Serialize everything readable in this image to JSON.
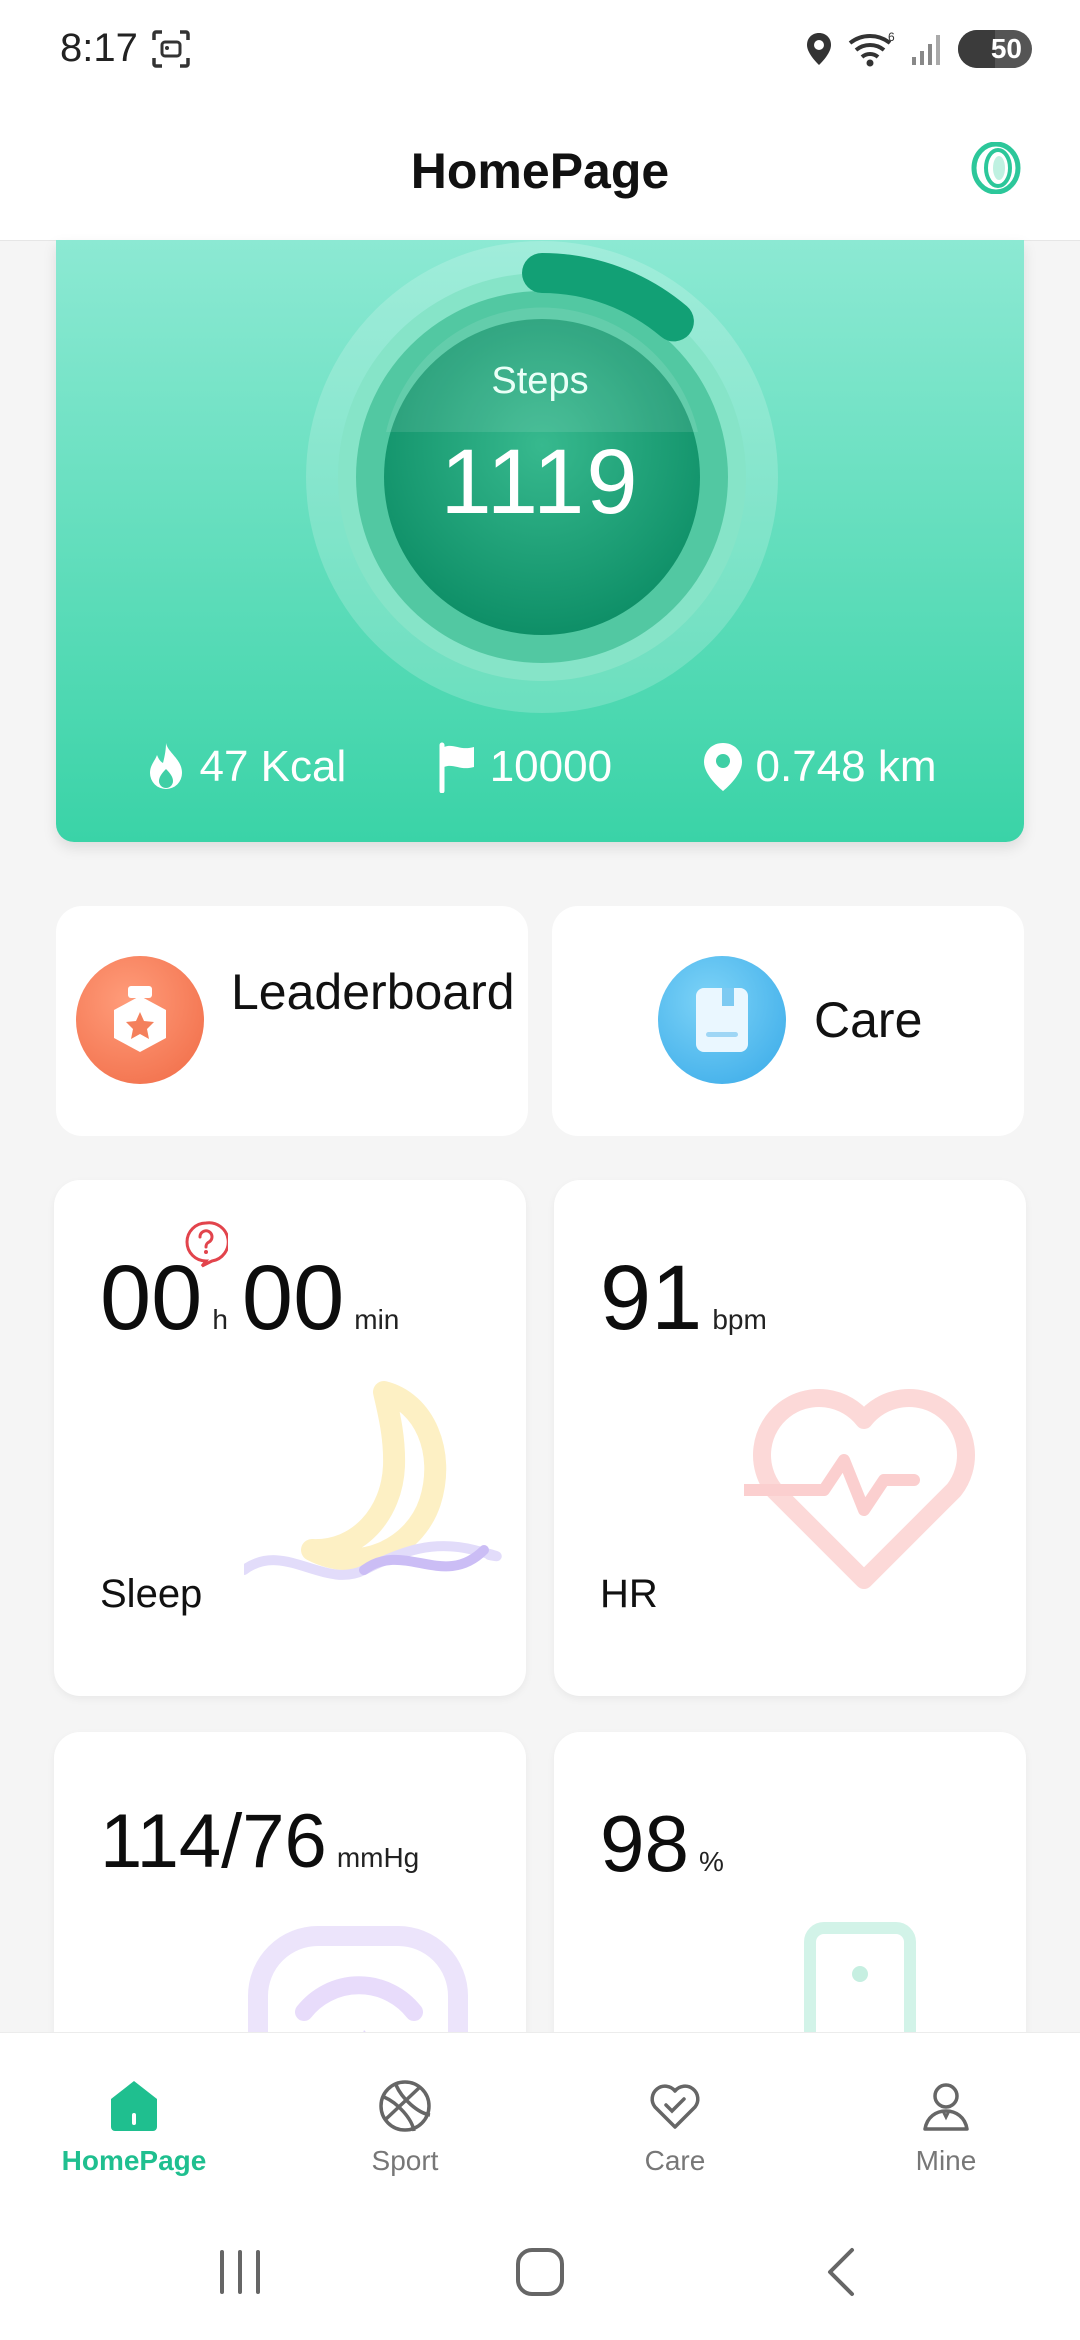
{
  "status_bar": {
    "time": "8:17",
    "battery": "50",
    "icons": [
      "screenshot-icon",
      "location-icon",
      "wifi-icon",
      "signal-icon",
      "battery-icon"
    ]
  },
  "header": {
    "title": "HomePage",
    "ring_icon": "smart-ring-icon"
  },
  "steps": {
    "label": "Steps",
    "value": "1119",
    "goal_progress": 0.1119,
    "calories": "47 Kcal",
    "goal": "10000",
    "distance": "0.748 km"
  },
  "quick_actions": [
    {
      "label": "Leaderboard",
      "icon": "medal-icon"
    },
    {
      "label": "Care",
      "icon": "book-icon"
    }
  ],
  "sleep": {
    "hours": "00",
    "hours_unit": "h",
    "minutes": "00",
    "minutes_unit": "min",
    "label": "Sleep"
  },
  "heart_rate": {
    "value": "91",
    "unit": "bpm",
    "label": "HR"
  },
  "blood_pressure": {
    "value": "114/76",
    "unit": "mmHg"
  },
  "spo2": {
    "value": "98",
    "unit": "%"
  },
  "bottom_nav": [
    {
      "label": "HomePage",
      "icon": "home-icon",
      "active": true
    },
    {
      "label": "Sport",
      "icon": "basketball-icon",
      "active": false
    },
    {
      "label": "Care",
      "icon": "heart-icon",
      "active": false
    },
    {
      "label": "Mine",
      "icon": "person-icon",
      "active": false
    }
  ],
  "colors": {
    "accent": "#1fbf8f",
    "card_gradient_top": "#8ce9d3",
    "card_gradient_bottom": "#3ad3a7"
  }
}
